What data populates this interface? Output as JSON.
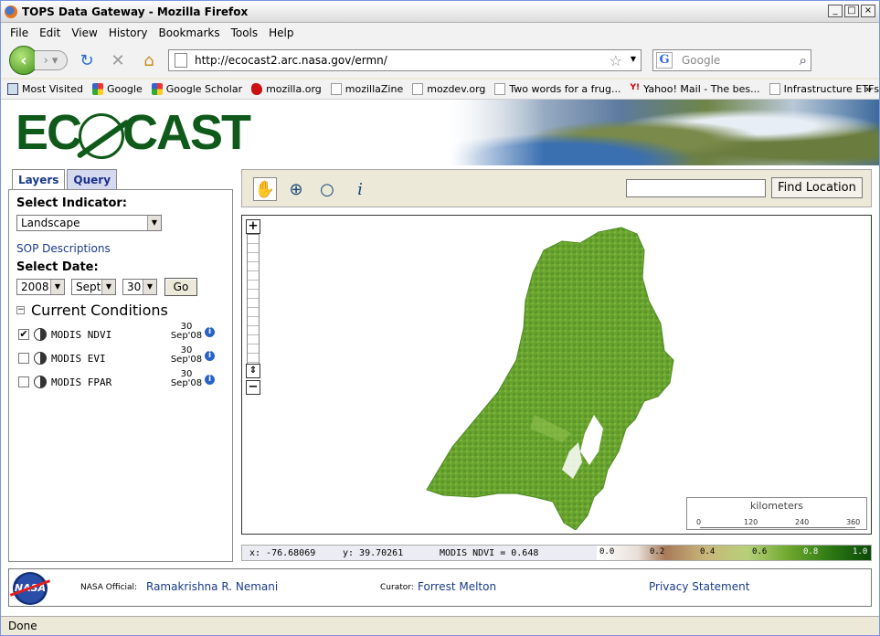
{
  "window": {
    "title": "TOPS Data Gateway - Mozilla Firefox",
    "min": "_",
    "max": "□",
    "close": "×"
  },
  "menu": [
    "File",
    "Edit",
    "View",
    "History",
    "Bookmarks",
    "Tools",
    "Help"
  ],
  "nav": {
    "url": "http://ecocast2.arc.nasa.gov/ermn/",
    "search_placeholder": "Google"
  },
  "bookmarks": [
    "Most Visited",
    "Google",
    "Google Scholar",
    "mozilla.org",
    "mozillaZine",
    "mozdev.org",
    "Two words for a frug...",
    "Yahoo! Mail - The bes...",
    "Infrastructure ETFs m..."
  ],
  "bookmarks_more": "»",
  "logo": {
    "left": "EC",
    "right": "CAST"
  },
  "tabs": {
    "layers": "Layers",
    "query": "Query"
  },
  "panel": {
    "select_indicator_label": "Select Indicator:",
    "indicator": "Landscape",
    "sop_link": "SOP Descriptions",
    "select_date_label": "Select Date:",
    "year": "2008",
    "month": "Sept",
    "day": "30",
    "go": "Go",
    "current_conditions": "Current Conditions",
    "layers": [
      {
        "name": "MODIS NDVI",
        "checked": "✔",
        "date_day": "30",
        "date_rest": "Sep'08"
      },
      {
        "name": "MODIS EVI",
        "checked": "",
        "date_day": "30",
        "date_rest": "Sep'08"
      },
      {
        "name": "MODIS FPAR",
        "checked": "",
        "date_day": "30",
        "date_rest": "Sep'08"
      }
    ]
  },
  "toolbar": {
    "find_button": "Find Location",
    "tools": [
      "pan-icon",
      "zoom-in-icon",
      "zoom-icon",
      "info-icon"
    ]
  },
  "map": {
    "zoom_in": "+",
    "zoom_out": "−",
    "zoom_slider": "⇕",
    "scale": {
      "title": "kilometers",
      "ticks": [
        "0",
        "120",
        "240",
        "360"
      ]
    }
  },
  "status_line": {
    "x": "x: -76.68069",
    "y": "y: 39.70261",
    "value": "MODIS NDVI = 0.648"
  },
  "legend": [
    "0.0",
    "0.2",
    "0.4",
    "0.6",
    "0.8",
    "1.0"
  ],
  "footer": {
    "nasa_logo": "NASA",
    "official_label": "NASA Official:",
    "official_name": "Ramakrishna R. Nemani",
    "curator_label": "Curator:",
    "curator_name": "Forrest Melton",
    "privacy": "Privacy Statement"
  },
  "status": "Done",
  "colors": {
    "accent": "#1a3a8a",
    "logo": "#0f5a1a",
    "vegetation": "#5a9a2a"
  }
}
